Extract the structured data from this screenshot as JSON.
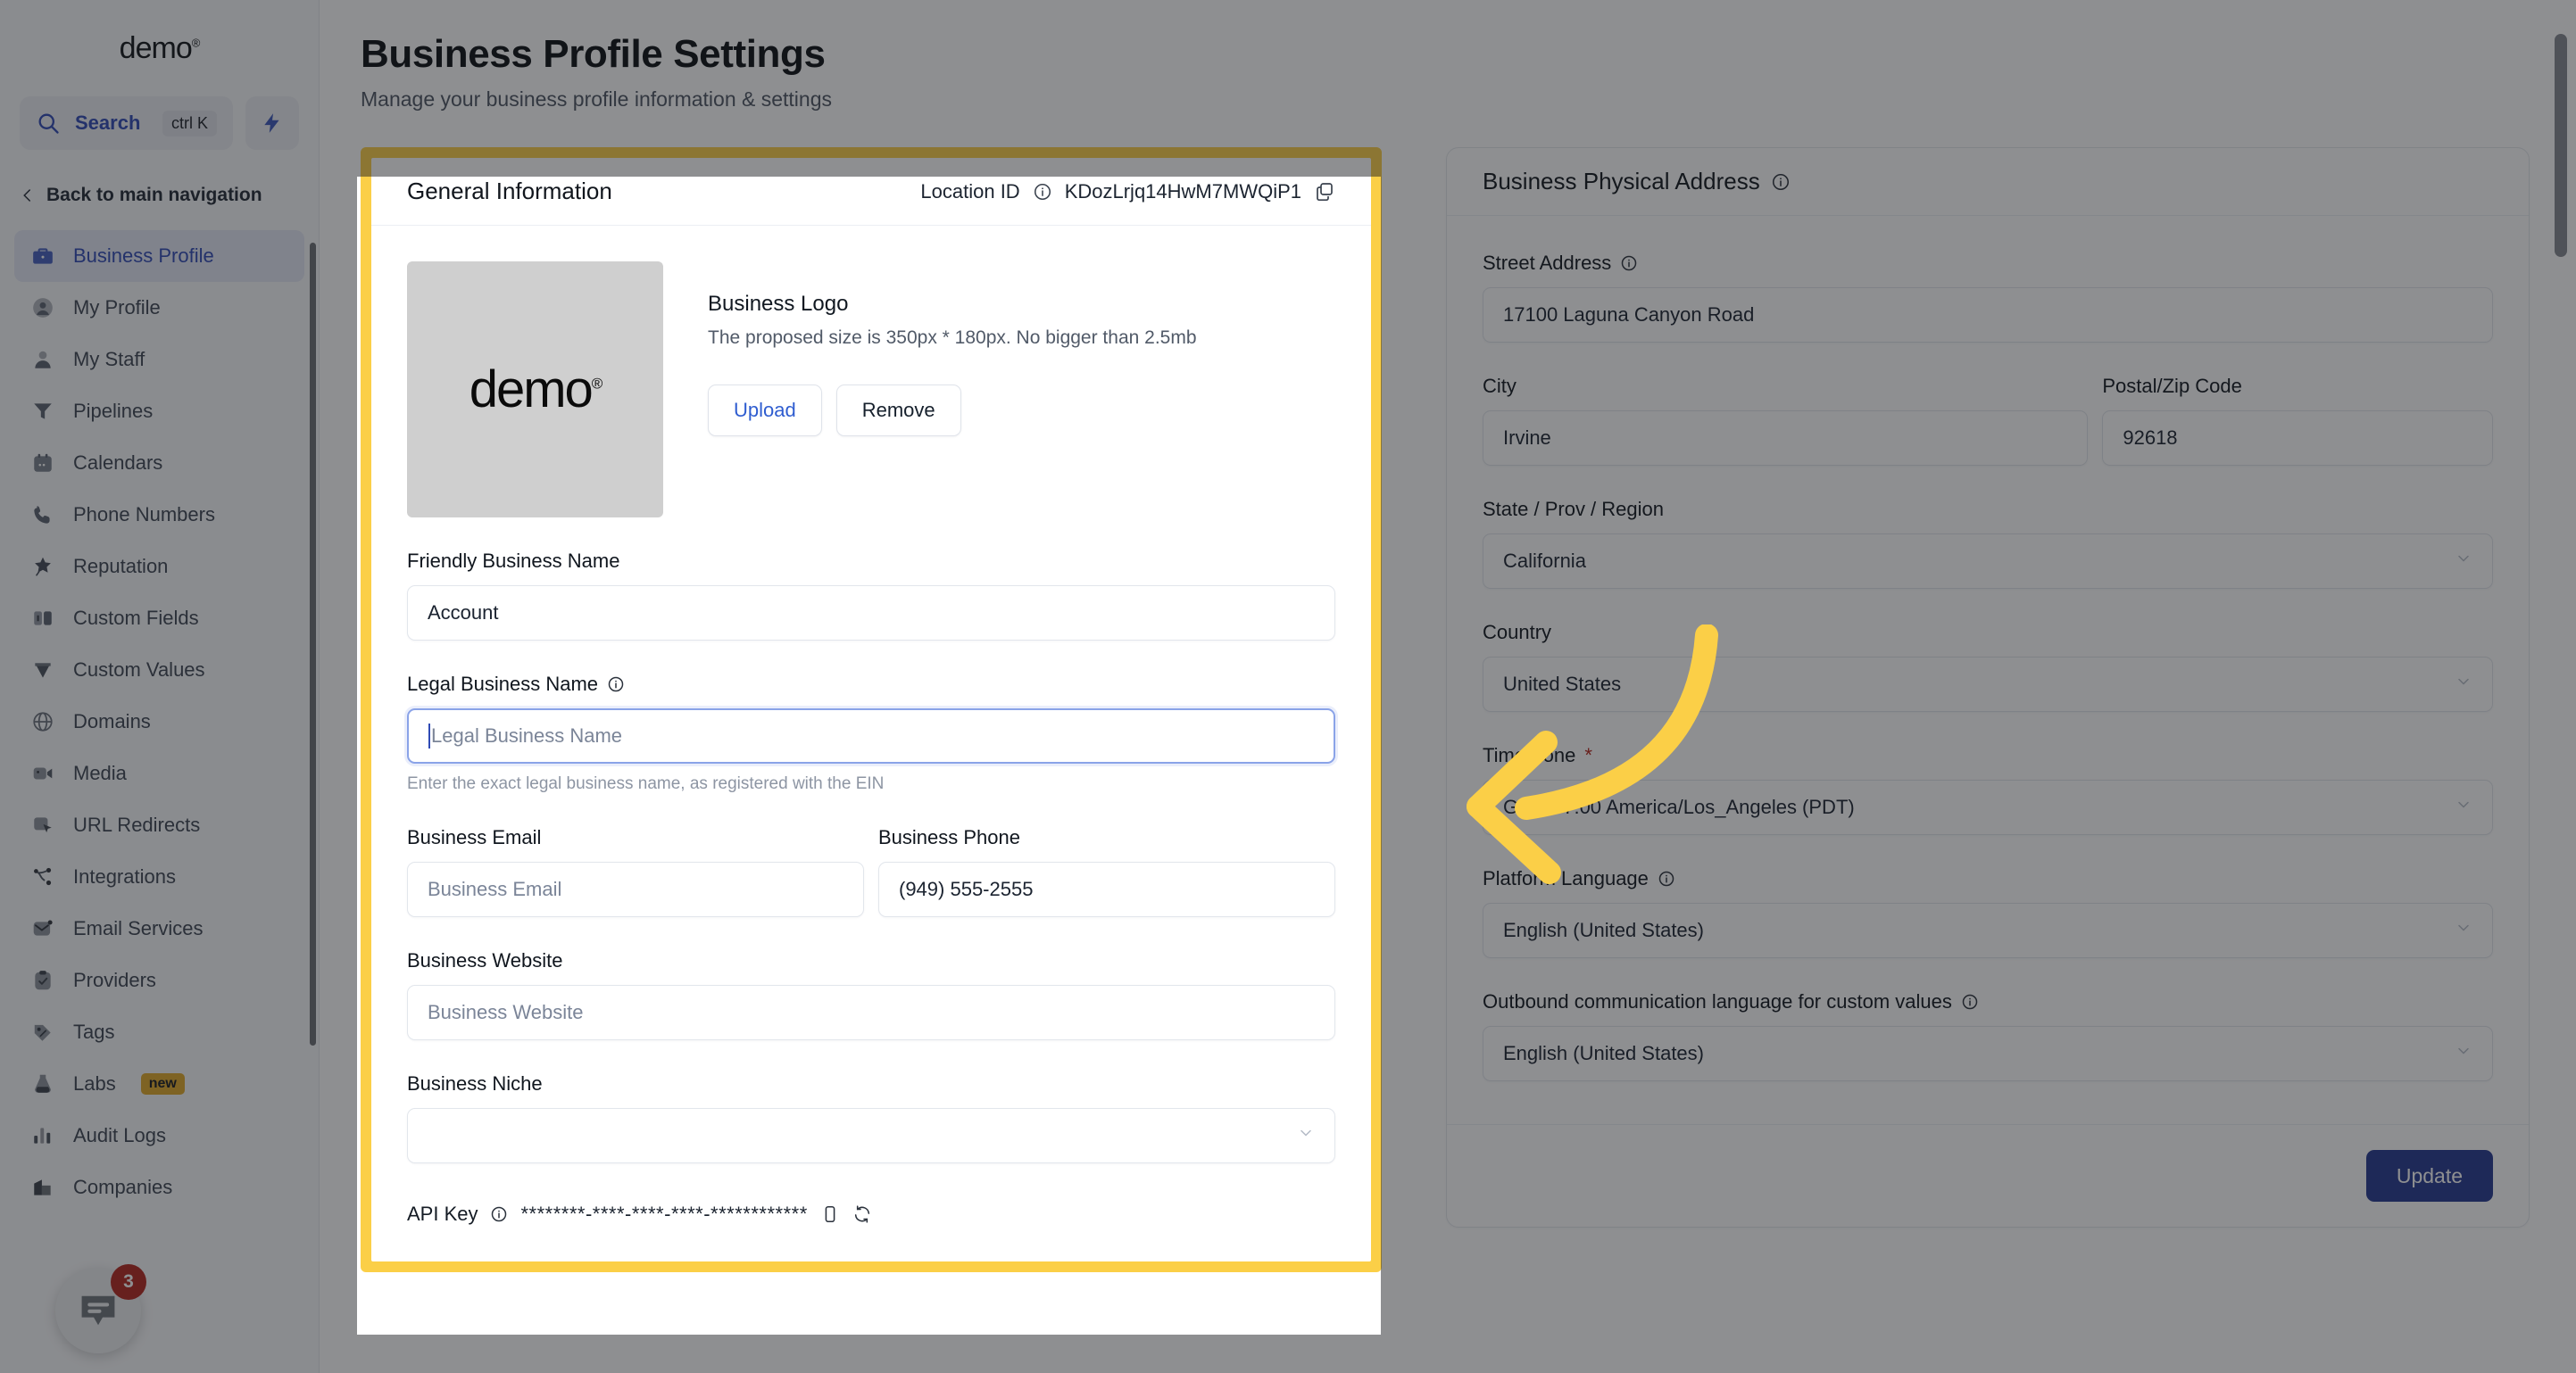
{
  "sidebar": {
    "brand": "demo",
    "brand_mark": "®",
    "search": {
      "label": "Search",
      "shortcut": "ctrl K",
      "icon": "search-icon"
    },
    "quick_action_icon": "lightning-bolt-icon",
    "back_link": "Back to main navigation",
    "items": [
      {
        "label": "Business Profile",
        "icon": "briefcase-icon",
        "active": true
      },
      {
        "label": "My Profile",
        "icon": "user-circle-icon",
        "active": false
      },
      {
        "label": "My Staff",
        "icon": "user-icon",
        "active": false
      },
      {
        "label": "Pipelines",
        "icon": "funnel-icon",
        "active": false
      },
      {
        "label": "Calendars",
        "icon": "calendar-icon",
        "active": false
      },
      {
        "label": "Phone Numbers",
        "icon": "phone-icon",
        "active": false
      },
      {
        "label": "Reputation",
        "icon": "star-sparkle-icon",
        "active": false
      },
      {
        "label": "Custom Fields",
        "icon": "columns-icon",
        "active": false
      },
      {
        "label": "Custom Values",
        "icon": "diamond-icon",
        "active": false
      },
      {
        "label": "Domains",
        "icon": "globe-icon",
        "active": false
      },
      {
        "label": "Media",
        "icon": "video-icon",
        "active": false
      },
      {
        "label": "URL Redirects",
        "icon": "cursor-square-icon",
        "active": false
      },
      {
        "label": "Integrations",
        "icon": "share-nodes-icon",
        "active": false
      },
      {
        "label": "Email Services",
        "icon": "mail-icon",
        "active": false
      },
      {
        "label": "Providers",
        "icon": "clipboard-check-icon",
        "active": false
      },
      {
        "label": "Tags",
        "icon": "tag-icon",
        "active": false
      },
      {
        "label": "Labs",
        "icon": "flask-icon",
        "badge": "new",
        "active": false
      },
      {
        "label": "Audit Logs",
        "icon": "bar-chart-icon",
        "active": false
      },
      {
        "label": "Companies",
        "icon": "building-icon",
        "active": false
      }
    ],
    "chat_widget": {
      "icon": "chat-bubble-icon",
      "badge_count": "3"
    }
  },
  "header": {
    "title": "Business Profile Settings",
    "subtitle": "Manage your business profile information & settings"
  },
  "general_information": {
    "card_title": "General Information",
    "location_id_label": "Location ID",
    "location_id_info_icon": "info-icon",
    "location_id_value": "KDozLrjq14HwM7MWQiP1",
    "copy_icon": "copy-icon",
    "logo": {
      "preview_text": "demo",
      "preview_mark": "®",
      "title": "Business Logo",
      "description": "The proposed size is 350px * 180px. No bigger than 2.5mb",
      "upload_label": "Upload",
      "remove_label": "Remove"
    },
    "friendly_business_name": {
      "label": "Friendly Business Name",
      "value": "Account",
      "placeholder": "Friendly Business Name"
    },
    "legal_business_name": {
      "label": "Legal Business Name",
      "info_icon": "info-icon",
      "value": "",
      "placeholder": "Legal Business Name",
      "hint": "Enter the exact legal business name, as registered with the EIN",
      "focused": true
    },
    "business_email": {
      "label": "Business Email",
      "value": "",
      "placeholder": "Business Email"
    },
    "business_phone": {
      "label": "Business Phone",
      "value": "(949) 555-2555",
      "placeholder": "Business Phone"
    },
    "business_website": {
      "label": "Business Website",
      "value": "",
      "placeholder": "Business Website"
    },
    "business_niche": {
      "label": "Business Niche",
      "value": "",
      "placeholder": ""
    },
    "api_key": {
      "label": "API Key",
      "info_icon": "info-icon",
      "value": "********-****-****-****-************",
      "copy_icon": "copy-icon",
      "refresh_icon": "refresh-icon"
    }
  },
  "physical_address": {
    "card_title": "Business Physical Address",
    "info_icon": "info-icon",
    "street_address": {
      "label": "Street Address",
      "info_icon": "info-icon",
      "value": "17100 Laguna Canyon Road"
    },
    "city": {
      "label": "City",
      "value": "Irvine"
    },
    "postal_code": {
      "label": "Postal/Zip Code",
      "value": "92618"
    },
    "state": {
      "label": "State / Prov / Region",
      "value": "California"
    },
    "country": {
      "label": "Country",
      "value": "United States"
    },
    "time_zone": {
      "label": "Time Zone",
      "required_mark": "*",
      "value": "GMT-07:00 America/Los_Angeles (PDT)"
    },
    "platform_language": {
      "label": "Platform Language",
      "info_icon": "info-icon",
      "value": "English (United States)"
    },
    "outbound_language": {
      "label": "Outbound communication language for custom values",
      "info_icon": "info-icon",
      "value": "English (United States)"
    },
    "update_button": "Update"
  },
  "annotation": {
    "arrow_icon": "curved-arrow-left-icon",
    "arrow_color": "#fbcf47",
    "highlight_color": "#fbcf47"
  }
}
